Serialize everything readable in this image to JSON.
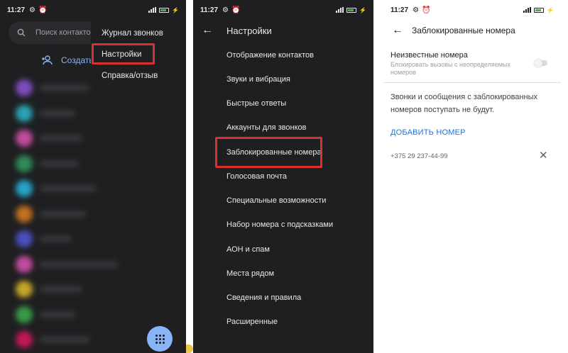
{
  "status": {
    "time": "11:27"
  },
  "screen1": {
    "search_placeholder": "Поиск контактов",
    "create_label": "Создать",
    "menu": [
      {
        "label": "Журнал звонков"
      },
      {
        "label": "Настройки"
      },
      {
        "label": "Справка/отзыв"
      }
    ],
    "contact_colors": [
      "#7c4dbd",
      "#29a3b3",
      "#c24c9f",
      "#2e8b57",
      "#26a3c4",
      "#c0701f",
      "#4a4fbf",
      "#c24c9f",
      "#c7a52a",
      "#3a9a4a",
      "#c2185b"
    ]
  },
  "screen2": {
    "title": "Настройки",
    "items": [
      {
        "label": "Отображение контактов"
      },
      {
        "label": "Звуки и вибрация"
      },
      {
        "label": "Быстрые ответы"
      },
      {
        "label": "Аккаунты для звонков"
      },
      {
        "label": "Заблокированные номера"
      },
      {
        "label": "Голосовая почта"
      },
      {
        "label": "Специальные возможности"
      },
      {
        "label": "Набор номера с подсказками"
      },
      {
        "label": "АОН и спам"
      },
      {
        "label": "Места рядом"
      },
      {
        "label": "Сведения и правила"
      },
      {
        "label": "Расширенные"
      }
    ]
  },
  "screen3": {
    "title": "Заблокированные номера",
    "unknown_title": "Неизвестные номера",
    "unknown_sub": "Блокировать вызовы с неопределяемых номеров",
    "toggle_on": false,
    "notice": "Звонки и сообщения с заблокированных номеров поступать не будут.",
    "add_label": "ДОБАВИТЬ НОМЕР",
    "blocked_number": "+375 29 237-44-99"
  },
  "colors": {
    "highlight": "#d93030",
    "accent_blue": "#1a73e8",
    "dark_bg": "#1f1f21"
  }
}
